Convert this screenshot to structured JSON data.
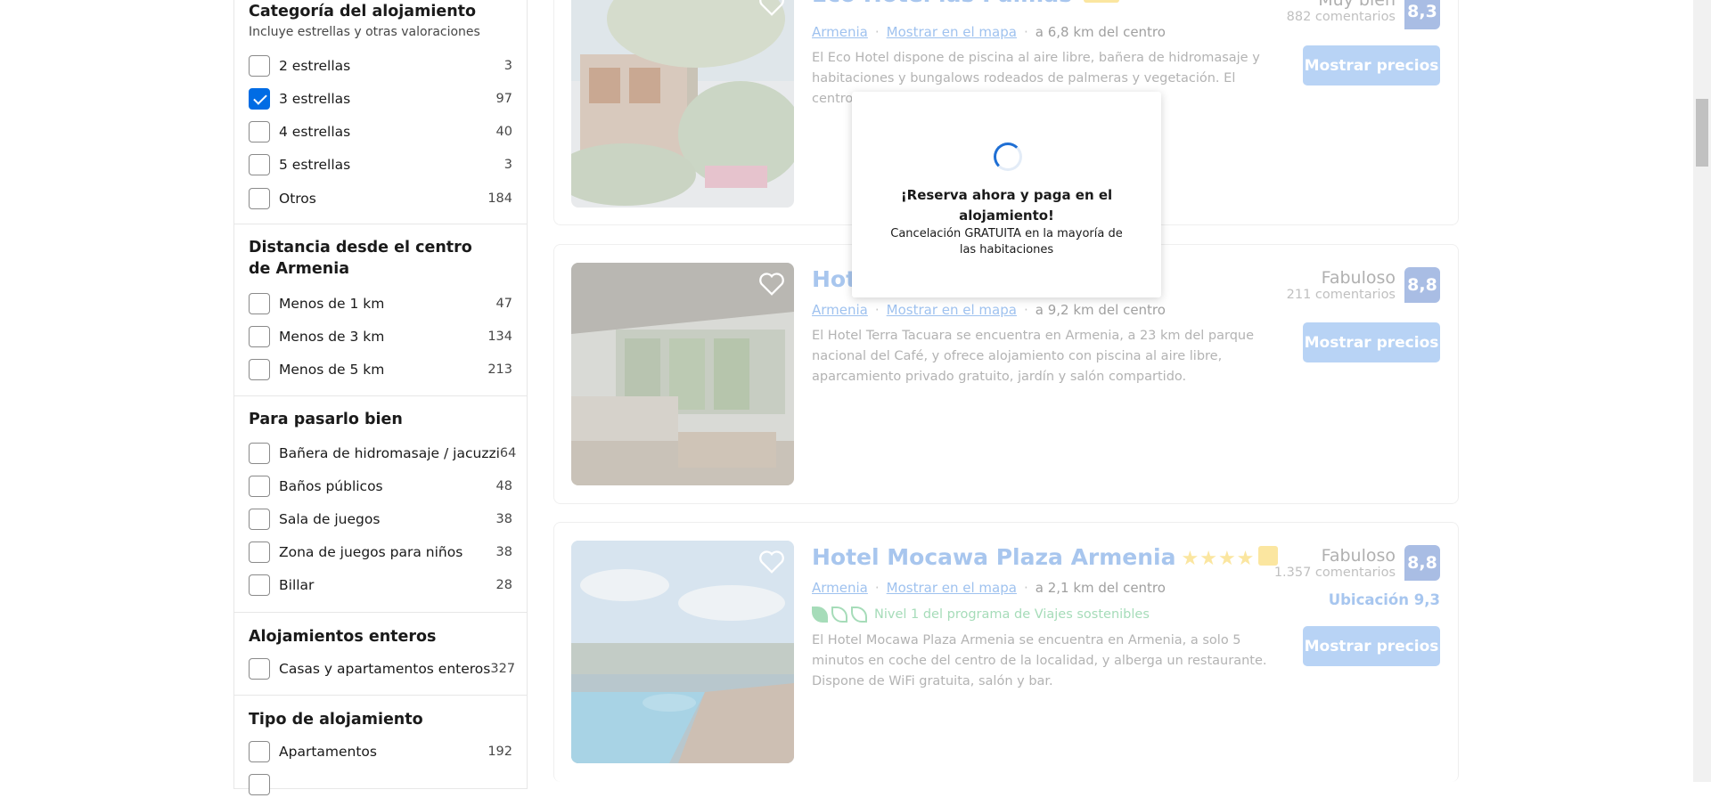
{
  "filters": {
    "category": {
      "title": "Categoría del alojamiento",
      "subtitle": "Incluye estrellas y otras valoraciones",
      "items": [
        {
          "label": "2 estrellas",
          "count": "3",
          "checked": false
        },
        {
          "label": "3 estrellas",
          "count": "97",
          "checked": true
        },
        {
          "label": "4 estrellas",
          "count": "40",
          "checked": false
        },
        {
          "label": "5 estrellas",
          "count": "3",
          "checked": false
        },
        {
          "label": "Otros",
          "count": "184",
          "checked": false
        }
      ]
    },
    "distance": {
      "title": "Distancia desde el centro de Armenia",
      "items": [
        {
          "label": "Menos de 1 km",
          "count": "47"
        },
        {
          "label": "Menos de 3 km",
          "count": "134"
        },
        {
          "label": "Menos de 5 km",
          "count": "213"
        }
      ]
    },
    "fun": {
      "title": "Para pasarlo bien",
      "items": [
        {
          "label": "Bañera de hidromasaje / jacuzzi",
          "count": "64"
        },
        {
          "label": "Baños públicos",
          "count": "48"
        },
        {
          "label": "Sala de juegos",
          "count": "38"
        },
        {
          "label": "Zona de juegos para niños",
          "count": "38"
        },
        {
          "label": "Billar",
          "count": "28"
        }
      ]
    },
    "entire": {
      "title": "Alojamientos enteros",
      "items": [
        {
          "label": "Casas y apartamentos enteros",
          "count": "327"
        }
      ]
    },
    "type": {
      "title": "Tipo de alojamiento",
      "items": [
        {
          "label": "Apartamentos",
          "count": "192"
        }
      ]
    }
  },
  "results": [
    {
      "name": "Eco Hotel las Palmas",
      "city": "Armenia",
      "map_link": "Mostrar en el mapa",
      "distance": "a 6,8 km del centro",
      "description": "El Eco Hotel dispone de piscina al aire libre, bañera de hidromasaje y habitaciones y bungalows rodeados de palmeras y vegetación. El centro de Armen",
      "rating_word": "Muy bien",
      "reviews": "882 comentarios",
      "score": "8,3",
      "button": "Mostrar precios"
    },
    {
      "name": "Hotel Terra Tacuara",
      "city": "Armenia",
      "map_link": "Mostrar en el mapa",
      "distance": "a 9,2 km del centro",
      "description": "El Hotel Terra Tacuara se encuentra en Armenia, a 23 km del parque nacional del Café, y ofrece alojamiento con piscina al aire libre, aparcamiento privado gratuito, jardín y salón compartido.",
      "rating_word": "Fabuloso",
      "reviews": "211 comentarios",
      "score": "8,8",
      "button": "Mostrar precios"
    },
    {
      "name": "Hotel Mocawa Plaza Armenia",
      "stars": "★★★★",
      "city": "Armenia",
      "map_link": "Mostrar en el mapa",
      "distance": "a 2,1 km del centro",
      "sustainable": "Nivel 1 del programa de Viajes sostenibles",
      "description": "El Hotel Mocawa Plaza Armenia se encuentra en Armenia, a solo 5 minutos en coche del centro de la localidad, y alberga un restaurante. Dispone de WiFi gratuita, salón y bar.",
      "rating_word": "Fabuloso",
      "reviews": "1.357 comentarios",
      "score": "8,8",
      "location_score": "Ubicación 9,3",
      "button": "Mostrar precios"
    }
  ],
  "popup": {
    "title": "¡Reserva ahora y paga en el alojamiento!",
    "subtitle": "Cancelación GRATUITA en la mayoría de las habitaciones"
  }
}
